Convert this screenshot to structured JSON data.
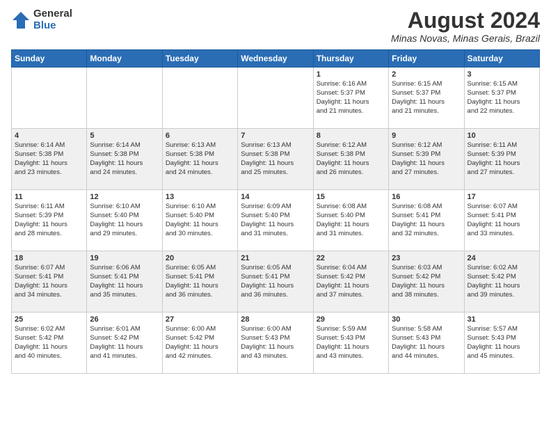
{
  "logo": {
    "general": "General",
    "blue": "Blue"
  },
  "title": "August 2024",
  "location": "Minas Novas, Minas Gerais, Brazil",
  "weekdays": [
    "Sunday",
    "Monday",
    "Tuesday",
    "Wednesday",
    "Thursday",
    "Friday",
    "Saturday"
  ],
  "weeks": [
    [
      {
        "day": "",
        "info": ""
      },
      {
        "day": "",
        "info": ""
      },
      {
        "day": "",
        "info": ""
      },
      {
        "day": "",
        "info": ""
      },
      {
        "day": "1",
        "info": "Sunrise: 6:16 AM\nSunset: 5:37 PM\nDaylight: 11 hours\nand 21 minutes."
      },
      {
        "day": "2",
        "info": "Sunrise: 6:15 AM\nSunset: 5:37 PM\nDaylight: 11 hours\nand 21 minutes."
      },
      {
        "day": "3",
        "info": "Sunrise: 6:15 AM\nSunset: 5:37 PM\nDaylight: 11 hours\nand 22 minutes."
      }
    ],
    [
      {
        "day": "4",
        "info": "Sunrise: 6:14 AM\nSunset: 5:38 PM\nDaylight: 11 hours\nand 23 minutes."
      },
      {
        "day": "5",
        "info": "Sunrise: 6:14 AM\nSunset: 5:38 PM\nDaylight: 11 hours\nand 24 minutes."
      },
      {
        "day": "6",
        "info": "Sunrise: 6:13 AM\nSunset: 5:38 PM\nDaylight: 11 hours\nand 24 minutes."
      },
      {
        "day": "7",
        "info": "Sunrise: 6:13 AM\nSunset: 5:38 PM\nDaylight: 11 hours\nand 25 minutes."
      },
      {
        "day": "8",
        "info": "Sunrise: 6:12 AM\nSunset: 5:38 PM\nDaylight: 11 hours\nand 26 minutes."
      },
      {
        "day": "9",
        "info": "Sunrise: 6:12 AM\nSunset: 5:39 PM\nDaylight: 11 hours\nand 27 minutes."
      },
      {
        "day": "10",
        "info": "Sunrise: 6:11 AM\nSunset: 5:39 PM\nDaylight: 11 hours\nand 27 minutes."
      }
    ],
    [
      {
        "day": "11",
        "info": "Sunrise: 6:11 AM\nSunset: 5:39 PM\nDaylight: 11 hours\nand 28 minutes."
      },
      {
        "day": "12",
        "info": "Sunrise: 6:10 AM\nSunset: 5:40 PM\nDaylight: 11 hours\nand 29 minutes."
      },
      {
        "day": "13",
        "info": "Sunrise: 6:10 AM\nSunset: 5:40 PM\nDaylight: 11 hours\nand 30 minutes."
      },
      {
        "day": "14",
        "info": "Sunrise: 6:09 AM\nSunset: 5:40 PM\nDaylight: 11 hours\nand 31 minutes."
      },
      {
        "day": "15",
        "info": "Sunrise: 6:08 AM\nSunset: 5:40 PM\nDaylight: 11 hours\nand 31 minutes."
      },
      {
        "day": "16",
        "info": "Sunrise: 6:08 AM\nSunset: 5:41 PM\nDaylight: 11 hours\nand 32 minutes."
      },
      {
        "day": "17",
        "info": "Sunrise: 6:07 AM\nSunset: 5:41 PM\nDaylight: 11 hours\nand 33 minutes."
      }
    ],
    [
      {
        "day": "18",
        "info": "Sunrise: 6:07 AM\nSunset: 5:41 PM\nDaylight: 11 hours\nand 34 minutes."
      },
      {
        "day": "19",
        "info": "Sunrise: 6:06 AM\nSunset: 5:41 PM\nDaylight: 11 hours\nand 35 minutes."
      },
      {
        "day": "20",
        "info": "Sunrise: 6:05 AM\nSunset: 5:41 PM\nDaylight: 11 hours\nand 36 minutes."
      },
      {
        "day": "21",
        "info": "Sunrise: 6:05 AM\nSunset: 5:41 PM\nDaylight: 11 hours\nand 36 minutes."
      },
      {
        "day": "22",
        "info": "Sunrise: 6:04 AM\nSunset: 5:42 PM\nDaylight: 11 hours\nand 37 minutes."
      },
      {
        "day": "23",
        "info": "Sunrise: 6:03 AM\nSunset: 5:42 PM\nDaylight: 11 hours\nand 38 minutes."
      },
      {
        "day": "24",
        "info": "Sunrise: 6:02 AM\nSunset: 5:42 PM\nDaylight: 11 hours\nand 39 minutes."
      }
    ],
    [
      {
        "day": "25",
        "info": "Sunrise: 6:02 AM\nSunset: 5:42 PM\nDaylight: 11 hours\nand 40 minutes."
      },
      {
        "day": "26",
        "info": "Sunrise: 6:01 AM\nSunset: 5:42 PM\nDaylight: 11 hours\nand 41 minutes."
      },
      {
        "day": "27",
        "info": "Sunrise: 6:00 AM\nSunset: 5:42 PM\nDaylight: 11 hours\nand 42 minutes."
      },
      {
        "day": "28",
        "info": "Sunrise: 6:00 AM\nSunset: 5:43 PM\nDaylight: 11 hours\nand 43 minutes."
      },
      {
        "day": "29",
        "info": "Sunrise: 5:59 AM\nSunset: 5:43 PM\nDaylight: 11 hours\nand 43 minutes."
      },
      {
        "day": "30",
        "info": "Sunrise: 5:58 AM\nSunset: 5:43 PM\nDaylight: 11 hours\nand 44 minutes."
      },
      {
        "day": "31",
        "info": "Sunrise: 5:57 AM\nSunset: 5:43 PM\nDaylight: 11 hours\nand 45 minutes."
      }
    ]
  ],
  "colors": {
    "header_bg": "#2a6db5",
    "accent_blue": "#2a6db5"
  }
}
